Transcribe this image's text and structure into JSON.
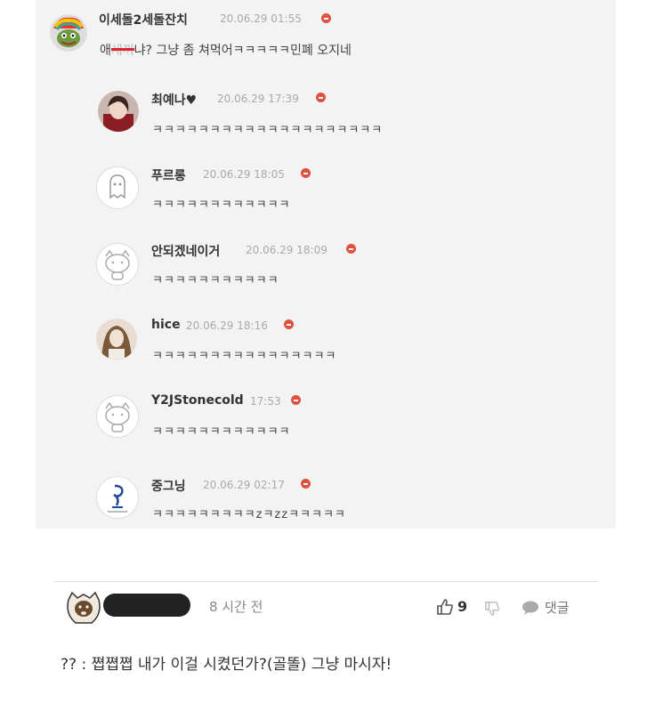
{
  "top": {
    "name": "이세돌2세돌잔치",
    "time": "20.06.29 01:55",
    "text_before": "애",
    "text_redacted": "새끼",
    "text_after": "냐? 그냥 좀 쳐먹어ㅋㅋㅋㅋㅋ민폐 오지네"
  },
  "replies": [
    {
      "name": "최예나♥",
      "time": "20.06.29 17:39",
      "text": "ㅋㅋㅋㅋㅋㅋㅋㅋㅋㅋㅋㅋㅋㅋㅋㅋㅋㅋㅋㅋ"
    },
    {
      "name": "푸르롱",
      "time": "20.06.29 18:05",
      "text": "ㅋㅋㅋㅋㅋㅋㅋㅋㅋㅋㅋㅋ"
    },
    {
      "name": "안되겠네이거",
      "time": "20.06.29 18:09",
      "text": "ㅋㅋㅋㅋㅋㅋㅋㅋㅋㅋㅋ"
    },
    {
      "name": "hice",
      "time": "20.06.29 18:16",
      "text": "ㅋㅋㅋㅋㅋㅋㅋㅋㅋㅋㅋㅋㅋㅋㅋㅋ"
    },
    {
      "name": "Y2JStonecold",
      "time": "17:53",
      "text": "ㅋㅋㅋㅋㅋㅋㅋㅋㅋㅋㅋㅋ"
    },
    {
      "name": "중그닝",
      "time": "20.06.29 02:17",
      "text": "ㅋㅋㅋㅋㅋㅋㅋㅋㅋzㅋzzㅋㅋㅋㅋㅋ"
    }
  ],
  "bottom": {
    "time": "8 시간 전",
    "likes": "9",
    "reply_label": "댓글",
    "text": "?? : 쪕쪕쪕 내가 이걸 시켰던가?(골똘) 그냥 마시자!"
  },
  "icons": {
    "delete": "delete-icon",
    "thumb_up": "thumb-up-icon",
    "thumb_down": "thumb-down-icon",
    "reply": "speech-bubble-icon"
  },
  "colors": {
    "accent": "#e0513f",
    "panel": "#f3f3f3"
  }
}
